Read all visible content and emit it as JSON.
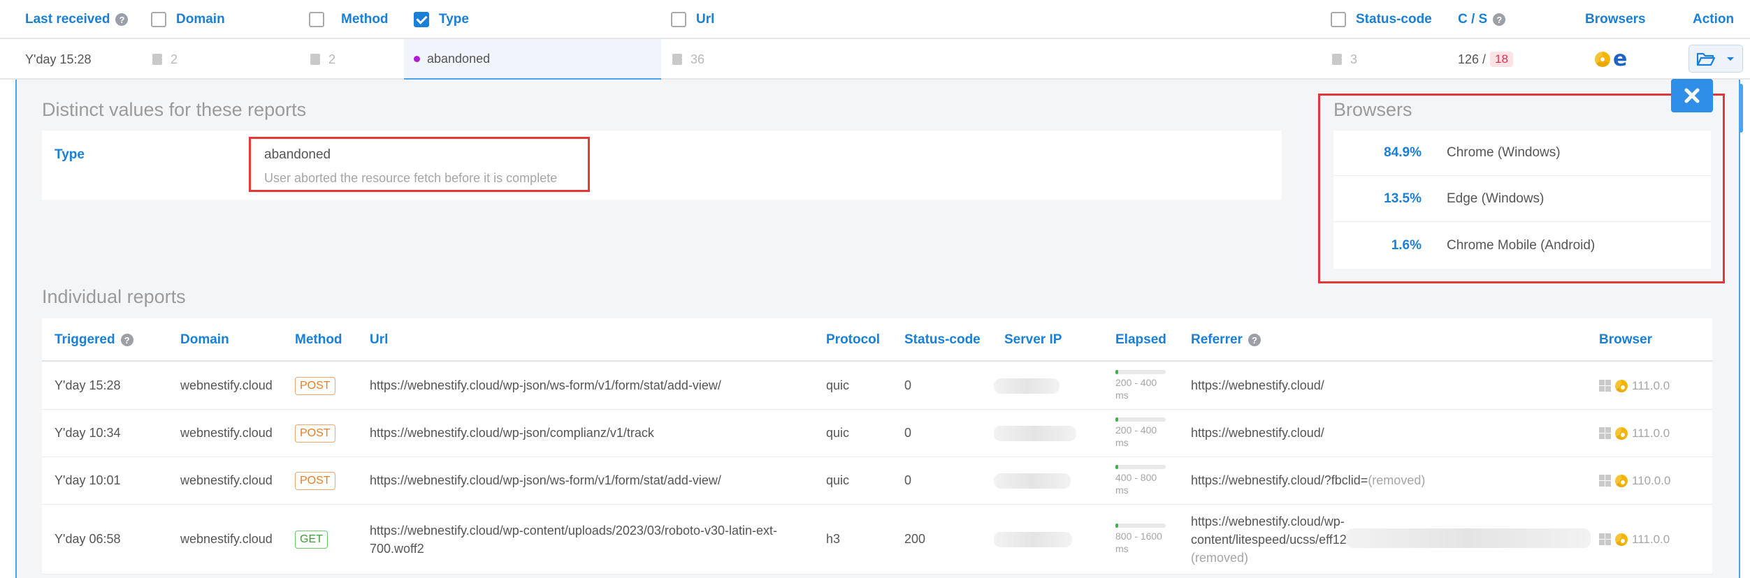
{
  "header": {
    "last_received": "Last received",
    "domain": "Domain",
    "method": "Method",
    "type": "Type",
    "url": "Url",
    "status_code": "Status-code",
    "cs": "C / S",
    "browsers": "Browsers",
    "action": "Action",
    "help_glyph": "?"
  },
  "summary_row": {
    "received": "Y'day 15:28",
    "domain_count": "2",
    "method_count": "2",
    "type_value": "abandoned",
    "url_count": "36",
    "status_count": "3",
    "cs_c": "126 /",
    "cs_s": "18"
  },
  "distinct": {
    "title": "Distinct values for these reports",
    "label": "Type",
    "value": "abandoned",
    "description": "User aborted the resource fetch before it is complete"
  },
  "browsers_panel": {
    "title": "Browsers",
    "items": [
      {
        "pct": "84.9%",
        "name": "Chrome (Windows)"
      },
      {
        "pct": "13.5%",
        "name": "Edge (Windows)"
      },
      {
        "pct": "1.6%",
        "name": "Chrome Mobile (Android)"
      }
    ]
  },
  "reports": {
    "title": "Individual reports",
    "columns": {
      "triggered": "Triggered",
      "domain": "Domain",
      "method": "Method",
      "url": "Url",
      "protocol": "Protocol",
      "status_code": "Status-code",
      "server_ip": "Server IP",
      "elapsed": "Elapsed",
      "referrer": "Referrer",
      "browser": "Browser"
    },
    "rows": [
      {
        "triggered": "Y'day 15:28",
        "domain": "webnestify.cloud",
        "method": "POST",
        "url": "https://webnestify.cloud/wp-json/ws-form/v1/form/stat/add-view/",
        "protocol": "quic",
        "status": "0",
        "elapsed_1": "200 - 400",
        "elapsed_2": "ms",
        "referrer": "https://webnestify.cloud/",
        "referrer_extra": "",
        "version": "111.0.0"
      },
      {
        "triggered": "Y'day 10:34",
        "domain": "webnestify.cloud",
        "method": "POST",
        "url": "https://webnestify.cloud/wp-json/complianz/v1/track",
        "protocol": "quic",
        "status": "0",
        "elapsed_1": "200 - 400",
        "elapsed_2": "ms",
        "referrer": "https://webnestify.cloud/",
        "referrer_extra": "",
        "version": "111.0.0"
      },
      {
        "triggered": "Y'day 10:01",
        "domain": "webnestify.cloud",
        "method": "POST",
        "url": "https://webnestify.cloud/wp-json/ws-form/v1/form/stat/add-view/",
        "protocol": "quic",
        "status": "0",
        "elapsed_1": "400 - 800",
        "elapsed_2": "ms",
        "referrer": "https://webnestify.cloud/?fbclid=",
        "referrer_extra": "(removed)",
        "version": "110.0.0"
      },
      {
        "triggered": "Y'day 06:58",
        "domain": "webnestify.cloud",
        "method": "GET",
        "url_1": "https://webnestify.cloud/wp-content/uploads/2023/03/roboto-v30-latin-ext-",
        "url_2": "700.woff2",
        "protocol": "h3",
        "status": "200",
        "elapsed_1": "800 - 1600",
        "elapsed_2": "ms",
        "ref_1": "https://webnestify.cloud/wp-",
        "ref_2": "content/litespeed/ucss/eff12",
        "ref_3": "(removed)",
        "version": "111.0.0"
      }
    ]
  },
  "colors": {
    "accent": "#1a7fd7",
    "highlight_border": "#e23838",
    "post": "#f07c20",
    "get": "#34a034"
  },
  "icons": [
    "help-icon",
    "checkbox-icon",
    "layers-icon",
    "chrome-icon",
    "edge-icon",
    "folder-open-icon",
    "caret-down-icon",
    "close-icon",
    "windows-icon"
  ]
}
